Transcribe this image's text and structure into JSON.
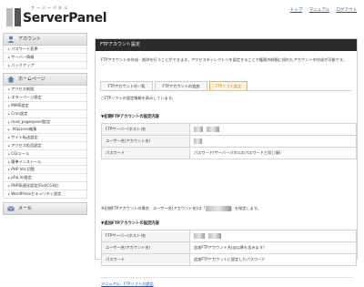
{
  "brand": {
    "sub": "サーバーパネル",
    "name": "ServerPanel"
  },
  "toplinks": [
    "トップ",
    "マニュアル",
    "ログアウト"
  ],
  "sidebar": {
    "account": {
      "title": "アカウント",
      "items": [
        "パスワード変更",
        "サーバー情報",
        "バックアップ"
      ]
    },
    "homepage": {
      "title": "ホームページ",
      "items": [
        "アクセス制限",
        "エラーページ設定",
        "MIME設定",
        "Cron設定",
        "mod_pagespeed設定",
        ".htaccess編集",
        "サイト転送設定",
        "アクセス拒否設定",
        "CGIツール",
        "簡単インストール",
        "PHP Ver.切替",
        "php.ini設定",
        "PHP高速化設定(FastCGI化)",
        "WordPressセキュリティ設定"
      ]
    },
    "mail": {
      "title": "メール"
    }
  },
  "main": {
    "title": "FTPアカウント設定",
    "description": "FTPアカウントの作成・削除を行うことができます。アクセスディレクトリを設定することで権限の制限に掛れたアカウントの作成が可能です。",
    "tabs": [
      "FTPアカウントの一覧",
      "FTPアカウントの追加",
      "FTPソフト設定"
    ],
    "notice": "○FTPソフトの設定情報を表示しています。",
    "initial": {
      "title": "▼初期FTPアカウントの設定内容",
      "rows": [
        {
          "key": "FTPサーバー(ホスト)名",
          "value": ""
        },
        {
          "key": "ユーザー名(アカウント名)",
          "value": ""
        },
        {
          "key": "パスワード",
          "value": "パスワード(サーバーパネルのパスワードと同じ値)"
        }
      ],
      "note": "※初期FTPアカウントの場合、ユーザー名(アカウント名)は「",
      "note_end": "」を指定します。"
    },
    "added": {
      "title": "▼追加FTPアカウントの設定内容",
      "rows": [
        {
          "key": "FTPサーバー(ホスト)名",
          "value": ""
        },
        {
          "key": "ユーザー名(アカウント名)",
          "value": "追加FTPアカウント名(@以降も含みます)"
        },
        {
          "key": "パスワード",
          "value": "追加FTPアカウントに設定したパスワード"
        }
      ]
    },
    "manual_link": "マニュアル：FTPソフトの設定"
  },
  "colors": {
    "header_bg": "#2b2b2b",
    "active_tab": "#e07a00",
    "link": "#2a55a8"
  }
}
